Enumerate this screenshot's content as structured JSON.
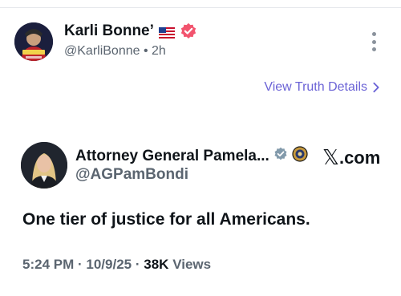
{
  "author": {
    "name": "Karli Bonne’",
    "handle": "@KarliBonne",
    "separator": "•",
    "time": "2h",
    "flag_icon": "us-flag-icon",
    "badge_icon": "verified-badge-icon",
    "badge_color": "#f2546e"
  },
  "actions": {
    "more_icon": "more-vertical-icon",
    "details_label": "View Truth Details",
    "details_color": "#6b63d6"
  },
  "embedded_post": {
    "name": "Attorney General Pamela...",
    "handle": "@AGPamBondi",
    "badge_icon": "gray-verified-badge-icon",
    "affiliation_icon": "doj-seal-icon",
    "source_label": ".com",
    "source_icon": "x-logo-icon",
    "text": "One tier of justice for all Americans.",
    "time": "5:24 PM",
    "date": "10/9/25",
    "views_count": "38K",
    "views_label": "Views",
    "sep": "·"
  }
}
